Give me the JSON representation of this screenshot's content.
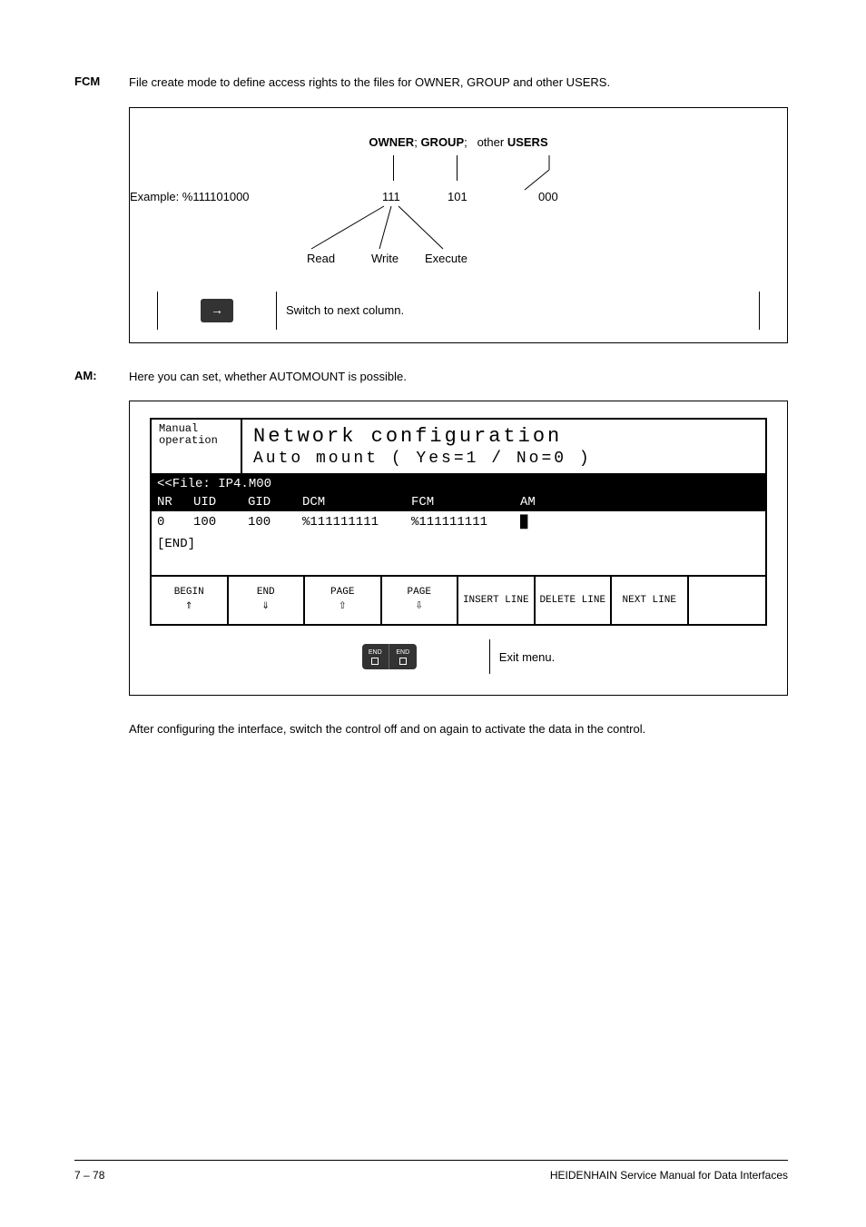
{
  "fcm": {
    "label": "FCM",
    "text": "File create mode to define access rights to the files for OWNER, GROUP and other USERS.",
    "headerOwner": "OWNER",
    "headerGroup": "GROUP",
    "headerOther": "other",
    "headerUsers": "USERS",
    "example": "Example: %111101000",
    "vals": {
      "a": "111",
      "b": "101",
      "c": "000"
    },
    "rwe": {
      "read": "Read",
      "write": "Write",
      "exec": "Execute"
    },
    "switch": "Switch to next column."
  },
  "am": {
    "label": "AM:",
    "text": "Here you can set, whether AUTOMOUNT is possible.",
    "mode": "Manual operation",
    "title": "Network configuration",
    "sub": "Auto mount ( Yes=1 / No=0 )",
    "file": "<<File: IP4.M00",
    "cols": {
      "nr": "NR",
      "uid": "UID",
      "gid": "GID",
      "dcm": "DCM",
      "fcm": "FCM",
      "am": "AM"
    },
    "row": {
      "nr": "0",
      "uid": "100",
      "gid": "100",
      "dcm": "%111111111",
      "fcm": "%111111111",
      "cursor": "█"
    },
    "end": "[END]",
    "softkeys": {
      "begin": "BEGIN",
      "end": "END",
      "pageu": "PAGE",
      "paged": "PAGE",
      "insert": "INSERT LINE",
      "delete": "DELETE LINE",
      "next": "NEXT LINE"
    },
    "keylabel": "END",
    "exit": "Exit menu."
  },
  "after": "After configuring the interface, switch the control off and on again to activate the data in the control.",
  "footer": {
    "left": "7 – 78",
    "right": "HEIDENHAIN Service Manual for Data Interfaces"
  }
}
